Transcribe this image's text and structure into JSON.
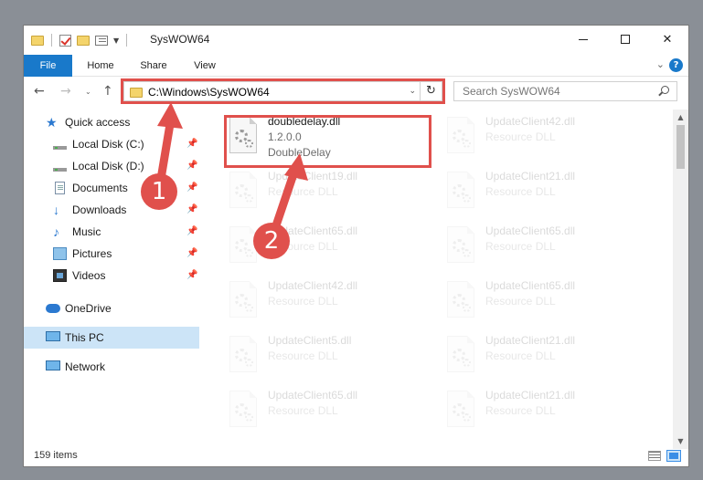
{
  "window": {
    "title": "SysWOW64",
    "controls": {
      "minimize": "–",
      "maximize": "□",
      "close": "✕"
    }
  },
  "ribbon": {
    "tabs": [
      "File",
      "Home",
      "Share",
      "View"
    ],
    "expand": "⌄",
    "help": "?"
  },
  "navbar": {
    "back": "←",
    "forward": "→",
    "recent": "⌄",
    "up": "↑",
    "address": "C:\\Windows\\SysWOW64",
    "address_dropdown": "⌄",
    "refresh": "↻",
    "search_placeholder": "Search SysWOW64"
  },
  "sidebar": {
    "quick_access": "Quick access",
    "pinned": [
      {
        "label": "Local Disk (C:)",
        "icon": "drive-icon"
      },
      {
        "label": "Local Disk (D:)",
        "icon": "drive-icon"
      },
      {
        "label": "Documents",
        "icon": "documents-icon"
      },
      {
        "label": "Downloads",
        "icon": "downloads-icon"
      },
      {
        "label": "Music",
        "icon": "music-icon"
      },
      {
        "label": "Pictures",
        "icon": "pictures-icon"
      },
      {
        "label": "Videos",
        "icon": "videos-icon"
      }
    ],
    "pin_glyph": "📌",
    "onedrive": "OneDrive",
    "this_pc": "This PC",
    "network": "Network"
  },
  "files": [
    {
      "name": "doubledelay.dll",
      "line2": "1.2.0.0",
      "line3": "DoubleDelay",
      "faded": false
    },
    {
      "name": "UpdateClient42.dll",
      "line2": "Resource DLL",
      "faded": true
    },
    {
      "name": "UpdateClient19.dll",
      "line2": "Resource DLL",
      "faded": true
    },
    {
      "name": "UpdateClient21.dll",
      "line2": "Resource DLL",
      "faded": true
    },
    {
      "name": "UpdateClient65.dll",
      "line2": "Resource DLL",
      "faded": true
    },
    {
      "name": "UpdateClient65.dll",
      "line2": "Resource DLL",
      "faded": true
    },
    {
      "name": "UpdateClient42.dll",
      "line2": "Resource DLL",
      "faded": true
    },
    {
      "name": "UpdateClient65.dll",
      "line2": "Resource DLL",
      "faded": true
    },
    {
      "name": "UpdateClient5.dll",
      "line2": "Resource DLL",
      "faded": true
    },
    {
      "name": "UpdateClient21.dll",
      "line2": "Resource DLL",
      "faded": true
    },
    {
      "name": "UpdateClient65.dll",
      "line2": "Resource DLL",
      "faded": true
    },
    {
      "name": "UpdateClient21.dll",
      "line2": "Resource DLL",
      "faded": true
    }
  ],
  "status": {
    "item_count": "159 items"
  },
  "annotations": {
    "step1": "1",
    "step2": "2",
    "color": "#e0504c"
  }
}
